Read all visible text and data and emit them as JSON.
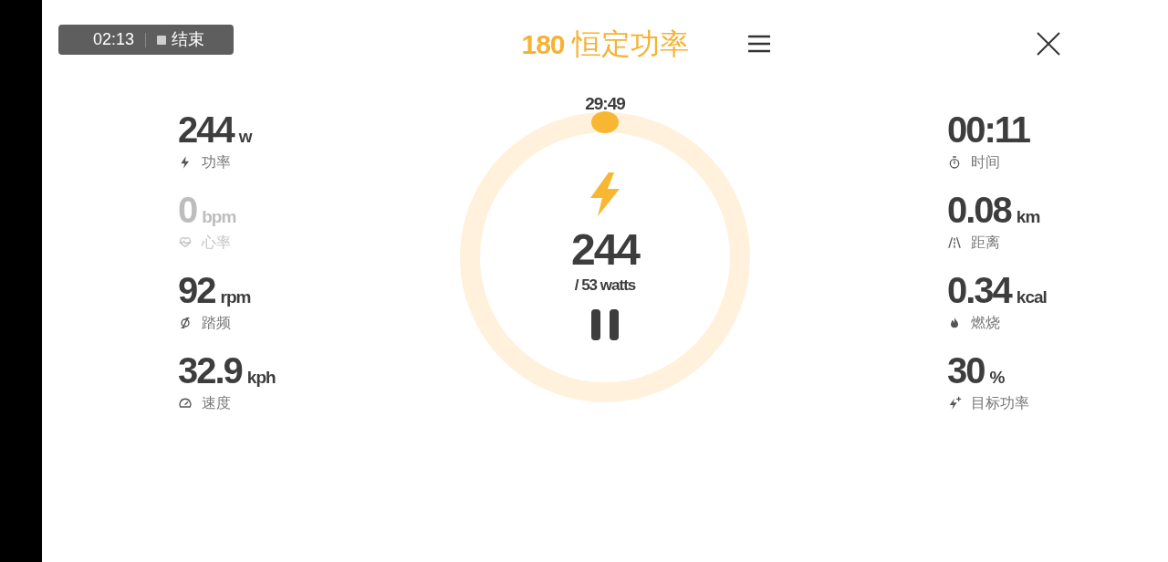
{
  "recorder": {
    "time": "02:13",
    "stop_label": "结束"
  },
  "header": {
    "title_number": "180",
    "title": "恒定功率"
  },
  "left_metrics": [
    {
      "kind": "power",
      "value": "244",
      "unit": "w",
      "label": "功率",
      "disabled": false
    },
    {
      "kind": "heart",
      "value": "0",
      "unit": "bpm",
      "label": "心率",
      "disabled": true
    },
    {
      "kind": "cadence",
      "value": "92",
      "unit": "rpm",
      "label": "踏频",
      "disabled": false
    },
    {
      "kind": "speed",
      "value": "32.9",
      "unit": "kph",
      "label": "速度",
      "disabled": false
    }
  ],
  "ring": {
    "timer": "29:49",
    "value": "244",
    "target": "/ 53 watts",
    "paused": false
  },
  "right_metrics": [
    {
      "kind": "time",
      "value": "00:11",
      "label": "时间",
      "disabled": false
    },
    {
      "kind": "distance",
      "value": "0.08",
      "unit": "km",
      "label": "距离",
      "disabled": false
    },
    {
      "kind": "calories",
      "value": "0.34",
      "unit": "kcal",
      "label": "燃烧",
      "disabled": false
    },
    {
      "kind": "target",
      "value": "30",
      "unit": "%",
      "label": "目标功率",
      "disabled": false
    }
  ]
}
